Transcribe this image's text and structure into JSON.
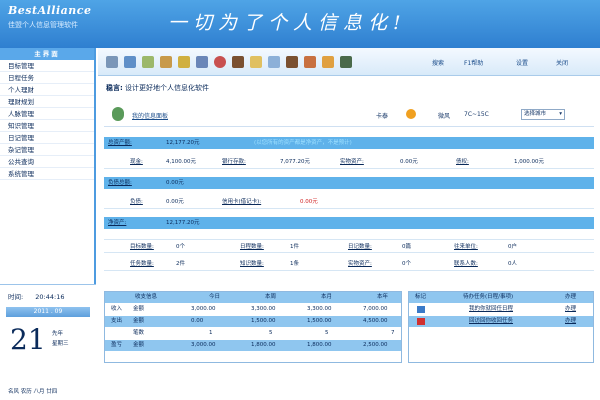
{
  "header": {
    "logo": "BestAlliance",
    "subtitle": "佳盟个人信息管理软件",
    "slogan": "一切为了个人信息化!"
  },
  "sidebar": {
    "title": "主界面",
    "items": [
      {
        "label": "目标管理"
      },
      {
        "label": "日程任务"
      },
      {
        "label": "个人理财"
      },
      {
        "label": "理财规划"
      },
      {
        "label": "人脉管理"
      },
      {
        "label": "知识管理"
      },
      {
        "label": "日记管理"
      },
      {
        "label": "杂记管理"
      },
      {
        "label": "公共查询"
      },
      {
        "label": "系统管理"
      }
    ]
  },
  "clock": {
    "time_label": "时间:",
    "time": "20:44:16",
    "year_month": "2011 . 09",
    "day": "21",
    "side1": "先年",
    "side2": "星期三",
    "footer": "名风  农历  八月 廿四"
  },
  "toolbar": {
    "links": [
      "搜索",
      "F1帮助",
      "设置",
      "关闭"
    ]
  },
  "main": {
    "crumb_prefix": "稳言:",
    "crumb_text": "设计更好地个人信息化软件",
    "my_info": "我的信息面板",
    "weather_label": "卡泰",
    "temp_label": "微风",
    "temp": "7C~15C",
    "city_select": "选择城市",
    "finance": {
      "assets_label": "总资产额:",
      "assets_value": "12,177.20元",
      "assets_note": "(以您所有的资产都是净资产，不是预计)",
      "cash_label": "现金:",
      "cash_value": "4,100.00元",
      "bank_label": "银行存款:",
      "bank_value": "7,077.20元",
      "invest_label": "实物资产:",
      "invest_value": "0.00元",
      "debt_label": "债权:",
      "debt_value": "1,000.00元",
      "liab_label": "负债总额:",
      "liab_value": "0.00元",
      "loan_label": "负债:",
      "loan_value": "0.00元",
      "credit_label": "信用卡(借记卡):",
      "credit_value": "0.00元",
      "net_label": "净资产:",
      "net_value": "12,177.20元"
    },
    "counts": {
      "r1": [
        {
          "label": "目标数量:",
          "value": "0个"
        },
        {
          "label": "日程数量:",
          "value": "1件"
        },
        {
          "label": "日记数量:",
          "value": "0篇"
        },
        {
          "label": "往来单位:",
          "value": "0户"
        }
      ],
      "r2": [
        {
          "label": "任务数量:",
          "value": "2件"
        },
        {
          "label": "知识数量:",
          "value": "1条"
        },
        {
          "label": "实物资产:",
          "value": "0个"
        },
        {
          "label": "联系人数:",
          "value": "0人"
        }
      ]
    },
    "budget": {
      "headers": [
        "收支信息",
        "今日",
        "本周",
        "本月",
        "本年"
      ],
      "rows": [
        {
          "c1": "收入",
          "c2": "金额",
          "v": [
            "3,000.00",
            "3,300.00",
            "3,300.00",
            "7,000.00"
          ]
        },
        {
          "c1": "支出",
          "c2": "金额",
          "v": [
            "0.00",
            "1,500.00",
            "1,500.00",
            "4,500.00"
          ]
        },
        {
          "c1": "",
          "c2": "笔数",
          "v": [
            "1",
            "5",
            "5",
            "7"
          ]
        },
        {
          "c1": "盈亏",
          "c2": "金额",
          "v": [
            "3,000.00",
            "1,800.00",
            "1,800.00",
            "2,500.00"
          ]
        }
      ]
    },
    "tasks": {
      "headers": [
        "标记",
        "待办任务(日程/事项)",
        "办理"
      ],
      "rows": [
        {
          "text": "我的你就回任日程",
          "action": "办理"
        },
        {
          "text": "回访回你收回任务",
          "action": "办理"
        }
      ]
    }
  }
}
